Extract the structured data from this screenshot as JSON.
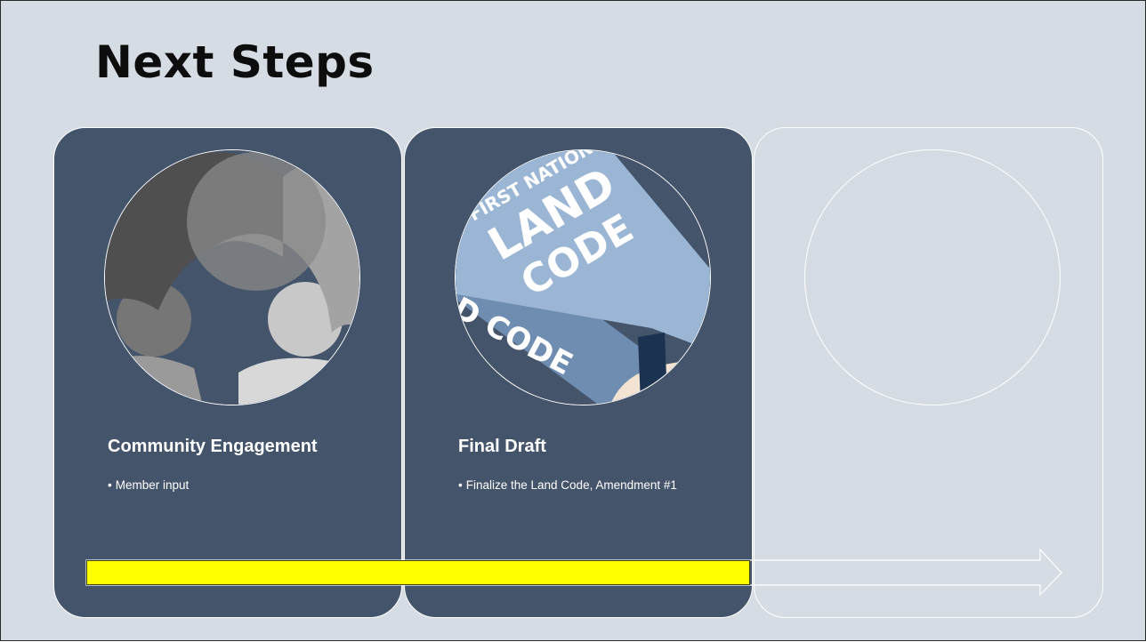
{
  "slide": {
    "title": "Next Steps",
    "colors": {
      "background": "#d6dce4",
      "card": "#44546a",
      "progress": "#ffff00"
    },
    "steps": [
      {
        "title": "Community Engagement",
        "bullet": "Member input",
        "icon": "people-icon"
      },
      {
        "title": "Final Draft",
        "bullet": "Finalize the Land Code, Amendment #1",
        "icon": "land-code-book-icon",
        "image_text": {
          "line1": "FIRST NATION",
          "line2": "LAND",
          "line3": "CODE",
          "spine": "D CODE"
        }
      },
      {
        "title": "",
        "bullet": "",
        "icon": ""
      }
    ],
    "progress": {
      "percent": 68
    }
  }
}
